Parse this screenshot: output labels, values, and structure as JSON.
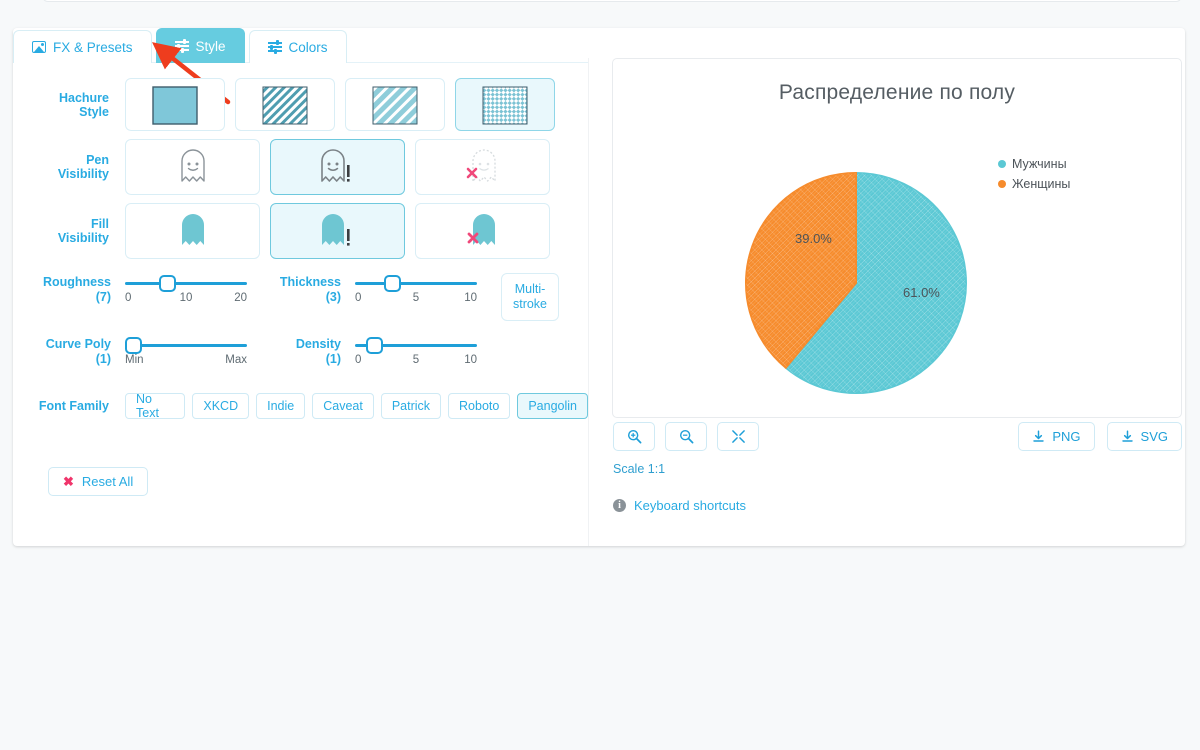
{
  "tabs": [
    {
      "label": "FX & Presets",
      "icon": "image-icon",
      "active": false
    },
    {
      "label": "Style",
      "icon": "sliders-icon",
      "active": true
    },
    {
      "label": "Colors",
      "icon": "sliders-icon",
      "active": false
    }
  ],
  "style_panel": {
    "hachure": {
      "label_line1": "Hachure",
      "label_line2": "Style",
      "options": [
        "solid",
        "hachure",
        "zigzag",
        "cross-hatch"
      ],
      "selected_index": 3
    },
    "pen_visibility": {
      "label_line1": "Pen",
      "label_line2": "Visibility",
      "options": [
        "normal",
        "emphasized",
        "hidden"
      ],
      "selected_index": 1
    },
    "fill_visibility": {
      "label_line1": "Fill",
      "label_line2": "Visibility",
      "options": [
        "normal",
        "emphasized",
        "hidden"
      ],
      "selected_index": 1
    },
    "sliders": [
      {
        "name": "roughness",
        "label": "Roughness",
        "value": "(7)",
        "value_num": 7,
        "min": 0,
        "max": 20,
        "ticks": [
          "0",
          "10",
          "20"
        ]
      },
      {
        "name": "thickness",
        "label": "Thickness",
        "value": "(3)",
        "value_num": 3,
        "min": 0,
        "max": 10,
        "ticks": [
          "0",
          "5",
          "10"
        ]
      },
      {
        "name": "curve-poly",
        "label": "Curve Poly",
        "value": "(1)",
        "value_num": 0,
        "min": 0,
        "max": 10,
        "ticks": [
          "Min",
          "Max"
        ]
      },
      {
        "name": "density",
        "label": "Density",
        "value": "(1)",
        "value_num": 1,
        "min": 0,
        "max": 10,
        "ticks": [
          "0",
          "5",
          "10"
        ]
      }
    ],
    "multi_stroke": {
      "line1": "Multi-",
      "line2": "stroke"
    },
    "font_family": {
      "label": "Font Family",
      "options": [
        "No Text",
        "XKCD",
        "Indie",
        "Caveat",
        "Patrick",
        "Roboto",
        "Pangolin"
      ],
      "selected_index": 6
    },
    "reset": {
      "label": "Reset All",
      "icon": "x-icon"
    }
  },
  "chart_data": {
    "type": "pie",
    "title": "Распределение по полу",
    "categories": [
      "Мужчины",
      "Женщины"
    ],
    "values": [
      61.0,
      39.0
    ],
    "labels": [
      "61.0%",
      "39.0%"
    ],
    "colors": [
      "#5bc8d4",
      "#f68b2c"
    ],
    "start_angle_deg": 0,
    "direction": "clockwise",
    "legend_position": "right",
    "grid": false,
    "xlabel": "",
    "ylabel": ""
  },
  "chart_toolbar": {
    "zoom_in": "zoom-in-icon",
    "zoom_out": "zoom-out-icon",
    "fit": "expand-icon",
    "png_label": "PNG",
    "svg_label": "SVG",
    "scale_text": "Scale 1:1",
    "keyboard_shortcuts": "Keyboard shortcuts",
    "info_glyph": "i"
  },
  "theme": {
    "accent": "#29abe2",
    "accent_dark": "#1e9fd8",
    "tab_active_bg": "#66cce0",
    "selected_bg": "#e9f8fc",
    "danger": "#f0356b",
    "arrow": "#ee3d1e",
    "pie_cyan": "#5bc8d4",
    "pie_orange": "#f68b2c"
  }
}
